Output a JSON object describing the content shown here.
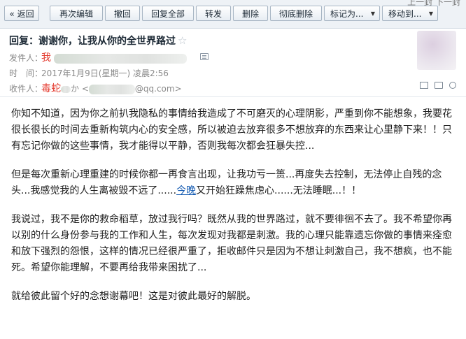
{
  "toolbar": {
    "buttons": [
      {
        "label": "« 返回"
      },
      {
        "label": "再次编辑"
      },
      {
        "label": "撤回"
      },
      {
        "label": "回复全部"
      },
      {
        "label": "转发"
      },
      {
        "label": "删除"
      },
      {
        "label": "彻底删除"
      },
      {
        "label": "标记为..."
      },
      {
        "label": "移动到..."
      }
    ],
    "corner_nav": "上一封  下一封"
  },
  "header": {
    "subject": "回复：谢谢你，让我从你的全世界路过",
    "star": "☆",
    "sender_label": "发件人：",
    "sender_name": "我",
    "time_label": "时　间：",
    "time_value": "2017年1月9日(星期一) 凌晨2:56",
    "recipient_label": "收件人：",
    "recipient_name": "毒蛇",
    "recipient_suffix": "か",
    "recipient_email_open": "<",
    "recipient_email_domain": "@qq.com>"
  },
  "body": {
    "paragraphs": [
      {
        "lines": [
          "你知不知道，因为你之前扒我隐私的事情给我造成了不可磨灭的心理阴影，严重到你不能想象，我要花",
          "很长很长的时间去重新构筑内心的安全感，所以被迫去放弃很多不想放弃的东西来让心里静下来！！只",
          "有忘记你做的这些事情，我才能得以平静，否则我每次都会狂暴失控..."
        ]
      },
      {
        "line1": "但是每次重新心理重建的时候你都一再食言出现，让我功亏一篑...再度失去控制，无法停止自残的念",
        "line2_before": "头...我感觉我的人生离被毁不远了......",
        "line2_link": "今晚",
        "line2_after": "又开始狂躁焦虑心......无法睡眠...！！"
      },
      {
        "lines": [
          "我说过，我不是你的救命稻草，放过我行吗？既然从我的世界路过，就不要徘徊不去了。我不希望你再",
          "以别的什么身份参与我的工作和人生，每次发现对我都是刺激。我的心理只能靠遗忘你做的事情来痊愈",
          "和放下强烈的怨恨，这样的情况已经很严重了，拒收邮件只是因为不想让刺激自己，我不想疯，也不能",
          "死。希望你能理解，不要再给我带来困扰了..."
        ]
      },
      {
        "lines": [
          "就给彼此留个好的念想谢幕吧！这是对彼此最好的解脱。"
        ]
      }
    ]
  },
  "colors": {
    "toolbar_bg": "#eef2f6",
    "name_red": "#e43b2f",
    "link_blue": "#1a5fb4",
    "meta_gray": "#8a8a8a"
  },
  "icons": [
    "star-icon",
    "contact-card-icon",
    "avatar",
    "print-icon",
    "new-window-icon",
    "zoom-icon"
  ]
}
